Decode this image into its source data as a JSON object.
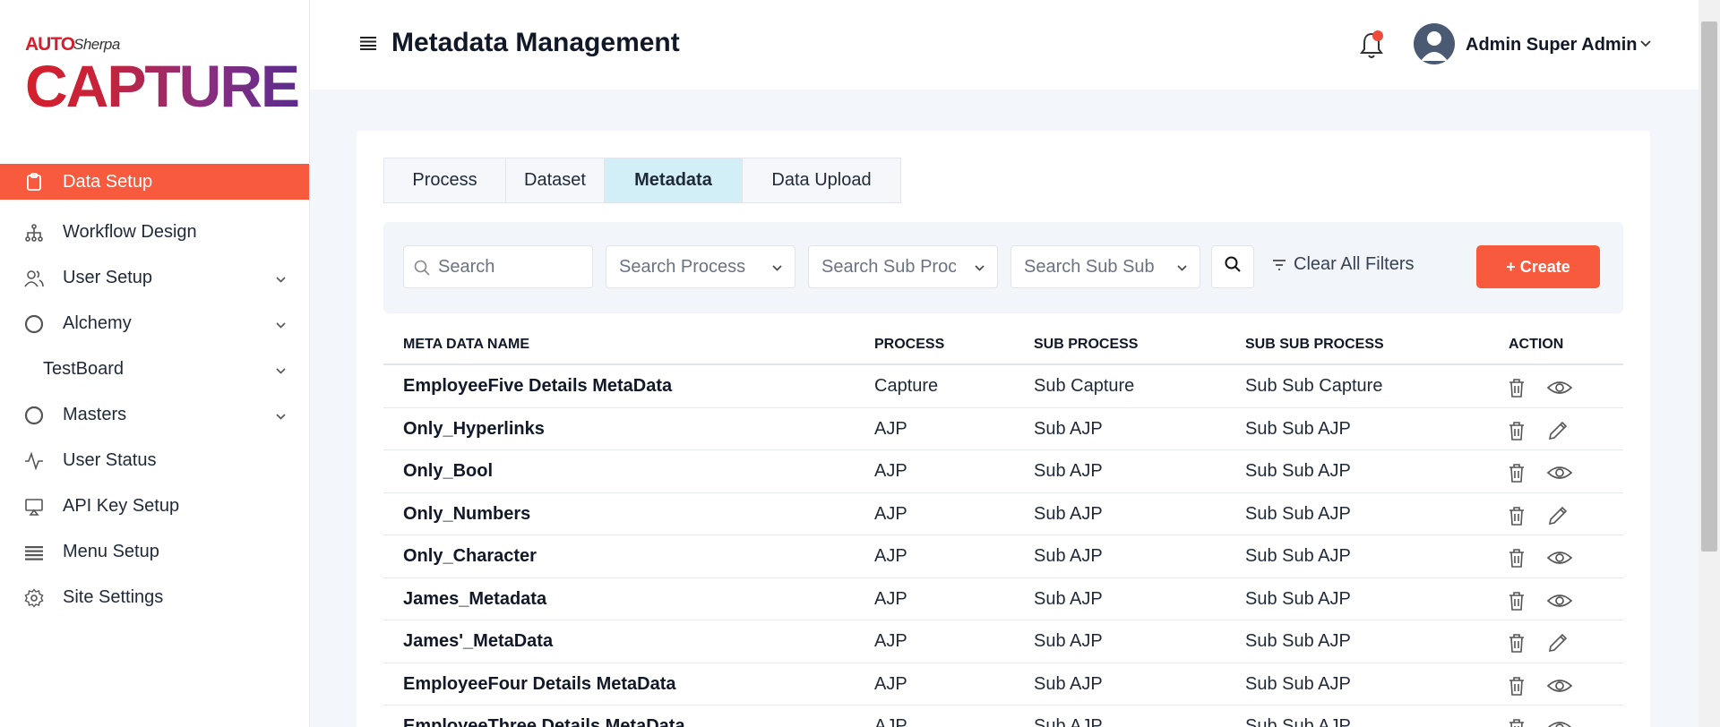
{
  "brand": {
    "auto": "AUTO",
    "sherpa": "Sherpa",
    "capture": "CAPTURE"
  },
  "sidebar": {
    "items": [
      {
        "label": "Data Setup",
        "icon": "clipboard-icon",
        "active": true,
        "expandable": false
      },
      {
        "label": "Workflow Design",
        "icon": "hierarchy-icon",
        "expandable": false
      },
      {
        "label": "User Setup",
        "icon": "users-icon",
        "expandable": true
      },
      {
        "label": "Alchemy",
        "icon": "circle-icon",
        "expandable": true
      },
      {
        "label": "TestBoard",
        "icon": "",
        "expandable": true
      },
      {
        "label": "Masters",
        "icon": "circle-icon",
        "expandable": true
      },
      {
        "label": "User Status",
        "icon": "activity-icon",
        "expandable": false
      },
      {
        "label": "API Key Setup",
        "icon": "monitor-icon",
        "expandable": false
      },
      {
        "label": "Menu Setup",
        "icon": "list-icon",
        "expandable": false
      },
      {
        "label": "Site Settings",
        "icon": "gear-icon",
        "expandable": false
      }
    ]
  },
  "header": {
    "title": "Metadata Management",
    "user_name": "Admin Super Admin"
  },
  "tabs": [
    {
      "label": "Process",
      "active": false
    },
    {
      "label": "Dataset",
      "active": false
    },
    {
      "label": "Metadata",
      "active": true
    },
    {
      "label": "Data Upload",
      "active": false
    }
  ],
  "filters": {
    "search_placeholder": "Search",
    "process_placeholder": "Search Process",
    "sub_process_placeholder": "Search Sub Proc",
    "sub_sub_process_placeholder": "Search Sub Sub",
    "clear_label": "Clear All Filters",
    "create_label": "+ Create"
  },
  "table": {
    "columns": [
      "META DATA NAME",
      "PROCESS",
      "SUB PROCESS",
      "SUB SUB PROCESS",
      "ACTION"
    ],
    "rows": [
      {
        "name": "EmployeeFive Details MetaData",
        "process": "Capture",
        "sub_process": "Sub Capture",
        "sub_sub_process": "Sub Sub Capture",
        "action": "view"
      },
      {
        "name": "Only_Hyperlinks",
        "process": "AJP",
        "sub_process": "Sub AJP",
        "sub_sub_process": "Sub Sub AJP",
        "action": "edit"
      },
      {
        "name": "Only_Bool",
        "process": "AJP",
        "sub_process": "Sub AJP",
        "sub_sub_process": "Sub Sub AJP",
        "action": "view"
      },
      {
        "name": "Only_Numbers",
        "process": "AJP",
        "sub_process": "Sub AJP",
        "sub_sub_process": "Sub Sub AJP",
        "action": "edit"
      },
      {
        "name": "Only_Character",
        "process": "AJP",
        "sub_process": "Sub AJP",
        "sub_sub_process": "Sub Sub AJP",
        "action": "view"
      },
      {
        "name": "James_Metadata",
        "process": "AJP",
        "sub_process": "Sub AJP",
        "sub_sub_process": "Sub Sub AJP",
        "action": "view"
      },
      {
        "name": "James'_MetaData",
        "process": "AJP",
        "sub_process": "Sub AJP",
        "sub_sub_process": "Sub Sub AJP",
        "action": "edit"
      },
      {
        "name": "EmployeeFour Details MetaData",
        "process": "AJP",
        "sub_process": "Sub AJP",
        "sub_sub_process": "Sub Sub AJP",
        "action": "view"
      },
      {
        "name": "EmployeeThree Details MetaData",
        "process": "AJP",
        "sub_process": "Sub AJP",
        "sub_sub_process": "Sub Sub AJP",
        "action": "view"
      }
    ]
  },
  "colors": {
    "accent": "#f85a3e",
    "active_tab": "#d2eef7",
    "background": "#f3f6fa"
  }
}
